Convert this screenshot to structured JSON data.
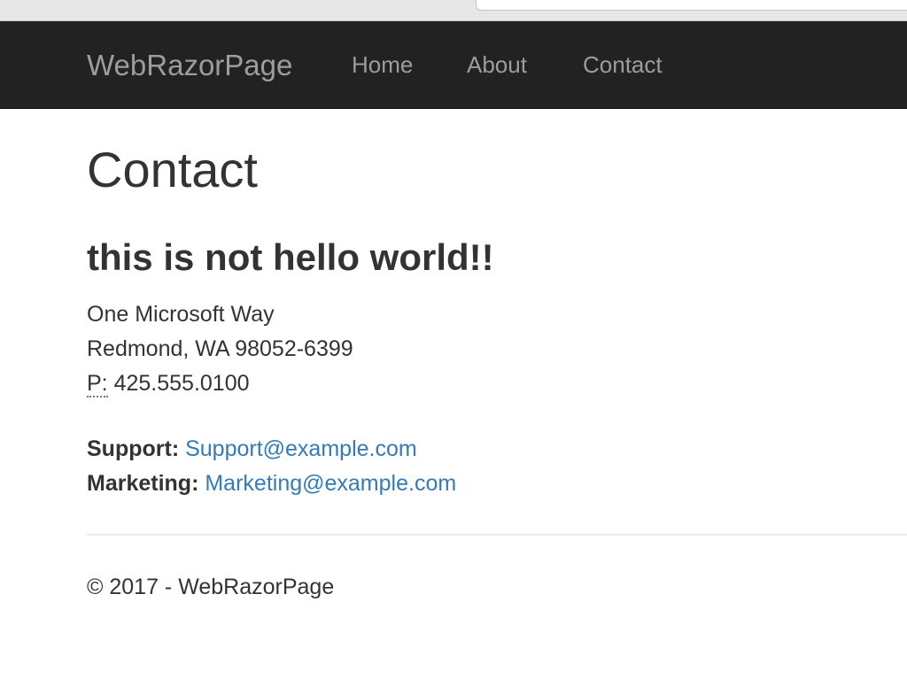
{
  "navbar": {
    "brand": "WebRazorPage",
    "links": [
      {
        "label": "Home"
      },
      {
        "label": "About"
      },
      {
        "label": "Contact"
      }
    ],
    "background": "#222222",
    "link_color": "#9d9d9d"
  },
  "main": {
    "title": "Contact",
    "subtitle": "this is not hello world!!",
    "address": {
      "line1": "One Microsoft Way",
      "line2": "Redmond, WA 98052-6399",
      "phone_label": "P:",
      "phone": "425.555.0100"
    },
    "contacts": {
      "support_label": "Support:",
      "support_email": "Support@example.com",
      "marketing_label": "Marketing:",
      "marketing_email": "Marketing@example.com"
    },
    "link_color": "#337ab7"
  },
  "footer": {
    "text": "© 2017 - WebRazorPage"
  }
}
